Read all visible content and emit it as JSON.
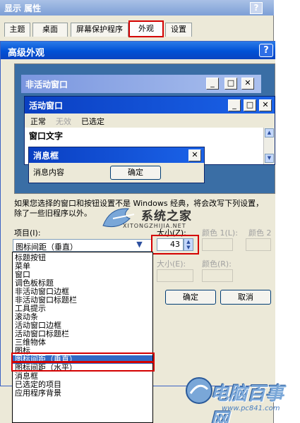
{
  "outer_dialog": {
    "title": "显示  属性",
    "help": "?",
    "tabs": [
      {
        "label": "主题",
        "active": false
      },
      {
        "label": "桌面",
        "active": false
      },
      {
        "label": "屏幕保护程序",
        "active": false
      },
      {
        "label": "外观",
        "active": true
      },
      {
        "label": "设置",
        "active": false
      }
    ]
  },
  "advanced_dialog": {
    "title": "高级外观",
    "help": "?",
    "preview": {
      "inactive_window_title": "非活动窗口",
      "active_window_title": "活动窗口",
      "menu": [
        {
          "label": "正常",
          "state": "normal"
        },
        {
          "label": "无效",
          "state": "disabled"
        },
        {
          "label": "已选定",
          "state": "selected"
        }
      ],
      "window_text": "窗口文字",
      "message_box": {
        "title": "消息框",
        "text": "消息内容",
        "ok": "确定"
      },
      "caption_buttons": {
        "minimize": "_",
        "maximize": "□",
        "close": "✕"
      }
    },
    "description": "如果您选择的窗口和按钮设置不是 Windows 经典，将会改写下列设置，除了一些旧程序以外。",
    "item_label": "项目(I):",
    "item_selected": "图标间距（垂直）",
    "size1_label": "大小(Z):",
    "size1_value": "43",
    "color1_label": "颜色 1(L):",
    "color2_label": "颜色 2",
    "size2_label": "大小(E):",
    "color_label": "颜色(R):",
    "items_list": [
      "标题按钮",
      "菜单",
      "窗口",
      "调色板标题",
      "非活动窗口边框",
      "非活动窗口标题栏",
      "工具提示",
      "滚动条",
      "活动窗口边框",
      "活动窗口标题栏",
      "三维物体",
      "图标",
      "图标间距（垂直）",
      "图标间距（水平）",
      "消息框",
      "已选定的项目",
      "应用程序背景"
    ],
    "list_selected_index": 12,
    "ok_button": "确定",
    "cancel_button": "取消"
  },
  "watermarks": {
    "logo1_text": "系统之家",
    "logo1_url": "XITONGZHIJIA.NET",
    "logo2_text": "电脑百事网",
    "logo2_url": "www.pc841.com"
  },
  "colors": {
    "active_title": "#0a3fc2",
    "inactive_title": "#7a96df",
    "desktop": "#3a6ea5",
    "selection": "#316ac5",
    "highlight_border": "#d40000"
  }
}
